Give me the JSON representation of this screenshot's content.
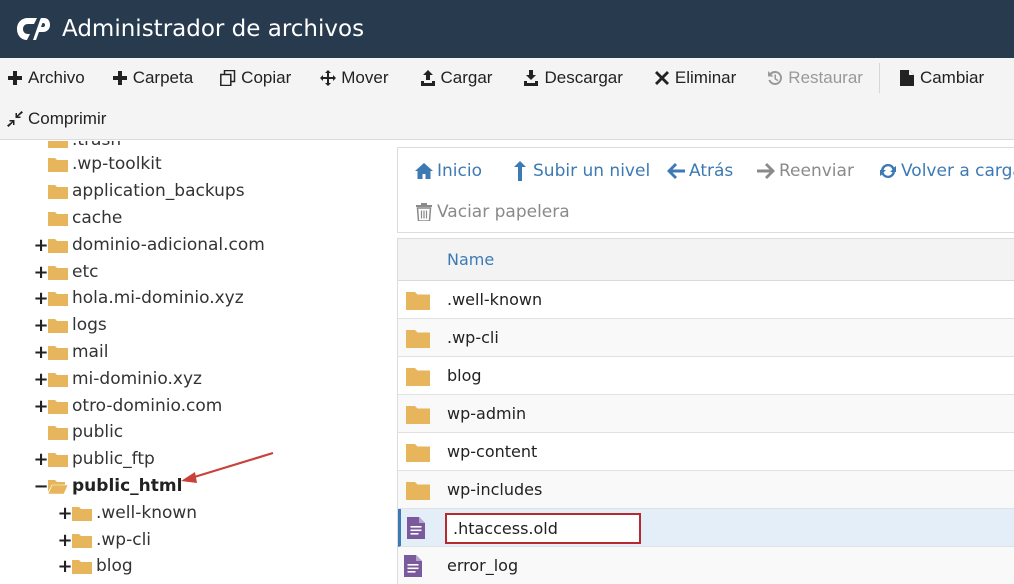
{
  "header": {
    "title": "Administrador de archivos",
    "logo_icon": "cpanel-logo-icon"
  },
  "toolbar": {
    "row1": [
      {
        "label": "Archivo",
        "icon": "plus-icon",
        "disabled": false
      },
      {
        "label": "Carpeta",
        "icon": "plus-icon",
        "disabled": false
      },
      {
        "label": "Copiar",
        "icon": "copy-icon",
        "disabled": false
      },
      {
        "label": "Mover",
        "icon": "move-icon",
        "disabled": false
      },
      {
        "label": "Cargar",
        "icon": "upload-icon",
        "disabled": false
      },
      {
        "label": "Descargar",
        "icon": "download-icon",
        "disabled": false
      },
      {
        "label": "Eliminar",
        "icon": "close-icon",
        "disabled": false
      },
      {
        "label": "Restaurar",
        "icon": "restore-icon",
        "disabled": true
      },
      {
        "label": "Cambiar",
        "icon": "file-icon",
        "disabled": false
      }
    ],
    "row2": [
      {
        "label": "Comprimir",
        "icon": "compress-icon",
        "disabled": false
      }
    ]
  },
  "tree": {
    "partial_top_label": ".trash",
    "items": [
      {
        "label": ".wp-toolkit",
        "expander": ""
      },
      {
        "label": "application_backups",
        "expander": ""
      },
      {
        "label": "cache",
        "expander": ""
      },
      {
        "label": "dominio-adicional.com",
        "expander": "+"
      },
      {
        "label": "etc",
        "expander": "+"
      },
      {
        "label": "hola.mi-dominio.xyz",
        "expander": "+"
      },
      {
        "label": "logs",
        "expander": "+"
      },
      {
        "label": "mail",
        "expander": "+"
      },
      {
        "label": "mi-dominio.xyz",
        "expander": "+"
      },
      {
        "label": "otro-dominio.com",
        "expander": "+"
      },
      {
        "label": "public",
        "expander": ""
      },
      {
        "label": "public_ftp",
        "expander": "+"
      },
      {
        "label": "public_html",
        "expander": "−"
      },
      {
        "label": ".well-known",
        "expander": "+"
      },
      {
        "label": ".wp-cli",
        "expander": "+"
      },
      {
        "label": "blog",
        "expander": "+"
      }
    ]
  },
  "nav": {
    "row1": [
      {
        "label": "Inicio",
        "icon": "home-icon",
        "disabled": false
      },
      {
        "label": "Subir un nivel",
        "icon": "level-up-icon",
        "disabled": false
      },
      {
        "label": "Atrás",
        "icon": "arrow-left-icon",
        "disabled": false
      },
      {
        "label": "Reenviar",
        "icon": "arrow-right-icon",
        "disabled": true
      },
      {
        "label": "Volver a cargar",
        "icon": "refresh-icon",
        "disabled": false
      }
    ],
    "row2": [
      {
        "label": "Vaciar papelera",
        "icon": "trash-icon",
        "disabled": true
      }
    ]
  },
  "files": {
    "column_name": "Name",
    "rows": [
      {
        "name": ".well-known",
        "type": "folder"
      },
      {
        "name": ".wp-cli",
        "type": "folder"
      },
      {
        "name": "blog",
        "type": "folder"
      },
      {
        "name": "wp-admin",
        "type": "folder"
      },
      {
        "name": "wp-content",
        "type": "folder"
      },
      {
        "name": "wp-includes",
        "type": "folder"
      },
      {
        "name": ".htaccess.old",
        "type": "file",
        "editing": true
      },
      {
        "name": "error_log",
        "type": "file"
      }
    ]
  },
  "colors": {
    "header_bg": "#273a4e",
    "link_blue": "#3d7ab3",
    "folder": "#e6b55c",
    "file_icon": "#7a5a9c",
    "highlight_row": "#e3eef8",
    "rename_border": "#b52a2f",
    "annotation_arrow": "#c8423a"
  }
}
